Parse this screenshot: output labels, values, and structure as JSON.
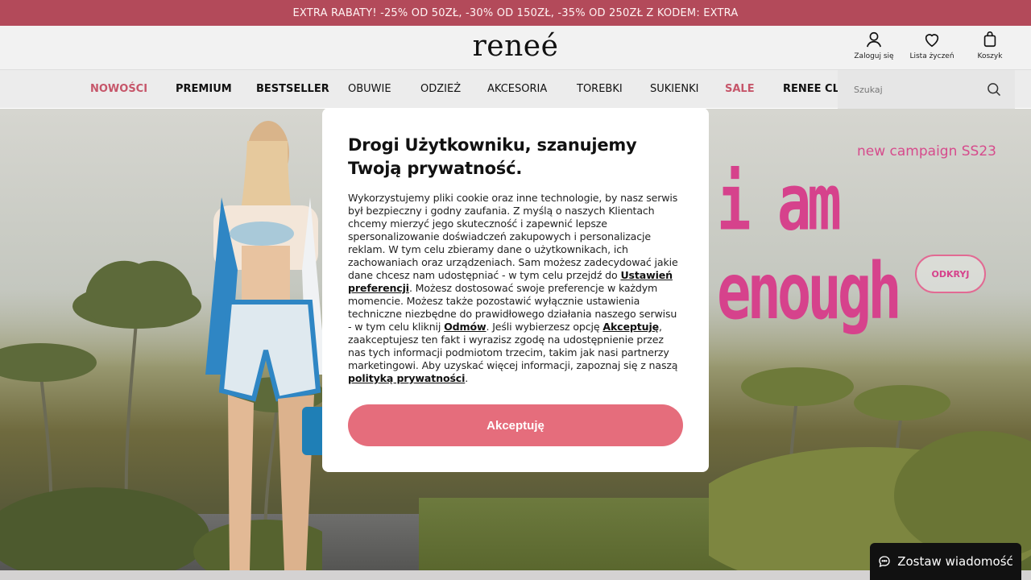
{
  "promo": {
    "text": "EXTRA RABATY! -25% OD 50ZŁ, -30% OD 150ZŁ, -35% OD 250ZŁ Z KODEM: EXTRA"
  },
  "header": {
    "logo": "reneé",
    "icons": [
      {
        "label": "Zaloguj się",
        "icon": "user-icon"
      },
      {
        "label": "Lista życzeń",
        "icon": "heart-icon"
      },
      {
        "label": "Koszyk",
        "icon": "bag-icon"
      }
    ]
  },
  "nav": {
    "items": [
      {
        "label": "NOWOŚCI",
        "style": "pink"
      },
      {
        "label": "PREMIUM",
        "style": "bold"
      },
      {
        "label": "BESTSELLER",
        "style": "bold"
      },
      {
        "label": "OBUWIE",
        "style": "regular"
      },
      {
        "label": "ODZIEŻ",
        "style": "regular"
      },
      {
        "label": "AKCESORIA",
        "style": "regular"
      },
      {
        "label": "TOREBKI",
        "style": "regular"
      },
      {
        "label": "SUKIENKI",
        "style": "regular"
      },
      {
        "label": "SALE",
        "style": "pink"
      },
      {
        "label": "RENEE CLU",
        "style": "bold"
      }
    ],
    "search_placeholder": "Szukaj"
  },
  "hero": {
    "campaign": "new campaign SS23",
    "slogan": "i am enough",
    "button": "ODKRYJ"
  },
  "modal": {
    "title": "Drogi Użytkowniku, szanujemy Twoją prywatność.",
    "text_1": "Wykorzystujemy pliki cookie oraz inne technologie, by nasz serwis był bezpieczny i godny zaufania. Z myślą o naszych Klientach chcemy mierzyć jego skuteczność i zapewnić lepsze spersonalizowanie doświadczeń zakupowych i personalizacje reklam. W tym celu zbieramy dane o użytkownikach, ich zachowaniach oraz urządzeniach. Sam możesz zadecydować jakie dane chcesz nam udostępniać - w tym celu przejdź do ",
    "link_preferences": "Ustawień preferencji",
    "text_2": ". Możesz dostosować swoje preferencje w każdym momencie. Możesz także pozostawić wyłącznie ustawienia techniczne niezbędne do prawidłowego działania naszego serwisu - w tym celu kliknij ",
    "link_reject": "Odmów",
    "text_3": ". Jeśli wybierzesz opcję ",
    "link_accept": "Akceptuję",
    "text_4": ", zaakceptujesz ten fakt i wyrazisz zgodę na udostępnienie przez nas tych informacji podmiotom trzecim, takim jak nasi partnerzy marketingowi. Aby uzyskać więcej informacji, zapoznaj się z naszą ",
    "link_policy": "polityką prywatności",
    "text_5": ".",
    "accept_button": "Akceptuję"
  },
  "chat": {
    "label": "Zostaw wiadomość",
    "icon": "chat-icon"
  },
  "colors": {
    "promo_bg": "#b34a5a",
    "accent_pink": "#d6428c",
    "accept_bg": "#e56d7c",
    "nav_pink": "#c6566a"
  }
}
